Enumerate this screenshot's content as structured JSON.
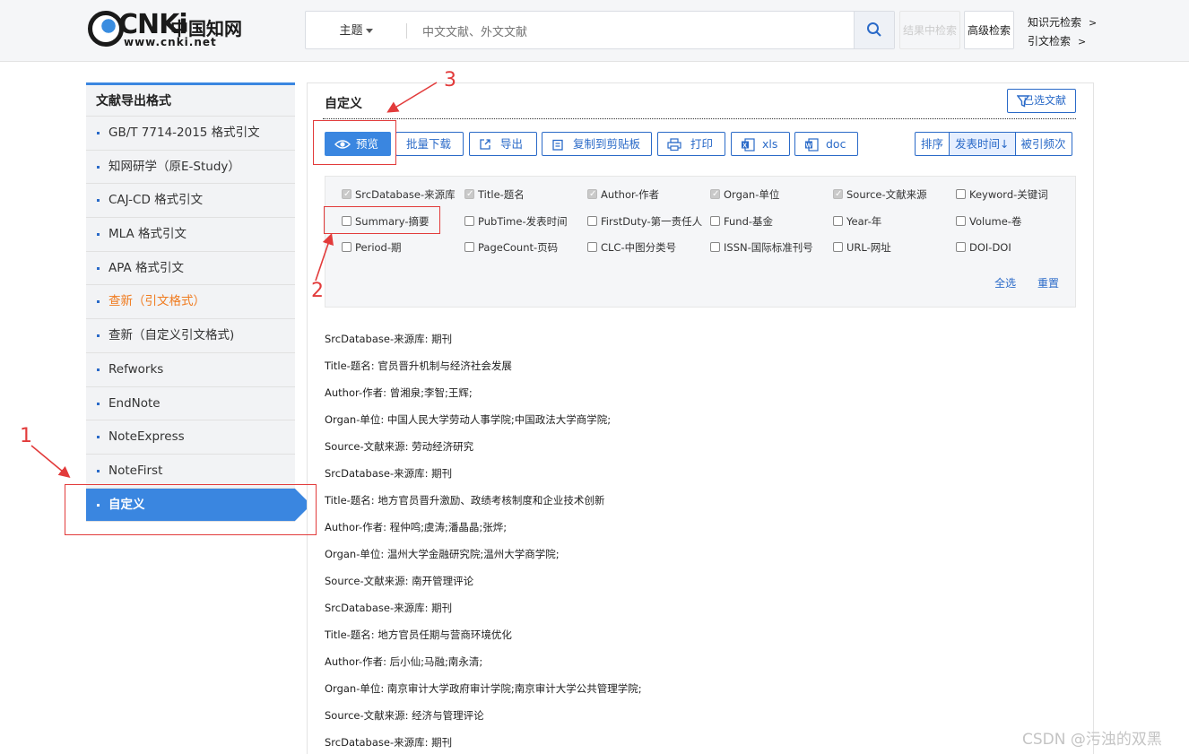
{
  "header": {
    "logo_word": "CNKi",
    "logo_cn": "中国知网",
    "logo_url": "www.cnki.net",
    "search_type": "主题",
    "search_placeholder": "中文文献、外文文献",
    "result_search": "结果中检索",
    "advanced_search": "高级检索",
    "link_knowledge": "知识元检索",
    "link_citation": "引文检索",
    "link_arrow": ">"
  },
  "sidebar": {
    "title": "文献导出格式",
    "items": [
      {
        "label": "GB/T 7714-2015 格式引文"
      },
      {
        "label": "知网研学（原E-Study）"
      },
      {
        "label": "CAJ-CD 格式引文"
      },
      {
        "label": "MLA 格式引文"
      },
      {
        "label": "APA 格式引文"
      },
      {
        "label": "查新（引文格式）"
      },
      {
        "label": "查新（自定义引文格式)"
      },
      {
        "label": "Refworks"
      },
      {
        "label": "EndNote"
      },
      {
        "label": "NoteExpress"
      },
      {
        "label": "NoteFirst"
      },
      {
        "label": "自定义"
      }
    ]
  },
  "main": {
    "title": "自定义",
    "selected_docs": "已选文献",
    "toolbar": {
      "preview": "预览",
      "batch_download": "批量下载",
      "export": "导出",
      "copy_clipboard": "复制到剪贴板",
      "print": "打印",
      "xls": "xls",
      "doc": "doc"
    },
    "sort": {
      "label": "排序",
      "publish_time": "发表时间",
      "publish_arrow": "↓",
      "cited": "被引频次"
    },
    "fields": [
      {
        "label": "SrcDatabase-来源库",
        "checked": true
      },
      {
        "label": "Title-题名",
        "checked": true
      },
      {
        "label": "Author-作者",
        "checked": true
      },
      {
        "label": "Organ-单位",
        "checked": true
      },
      {
        "label": "Source-文献来源",
        "checked": true
      },
      {
        "label": "Keyword-关键词",
        "checked": false
      },
      {
        "label": "Summary-摘要",
        "checked": false
      },
      {
        "label": "PubTime-发表时间",
        "checked": false
      },
      {
        "label": "FirstDuty-第一责任人",
        "checked": false
      },
      {
        "label": "Fund-基金",
        "checked": false
      },
      {
        "label": "Year-年",
        "checked": false
      },
      {
        "label": "Volume-卷",
        "checked": false
      },
      {
        "label": "Period-期",
        "checked": false
      },
      {
        "label": "PageCount-页码",
        "checked": false
      },
      {
        "label": "CLC-中图分类号",
        "checked": false
      },
      {
        "label": "ISSN-国际标准刊号",
        "checked": false
      },
      {
        "label": "URL-网址",
        "checked": false
      },
      {
        "label": "DOI-DOI",
        "checked": false
      }
    ],
    "select_all": "全选",
    "reset": "重置",
    "results": [
      "SrcDatabase-来源库: 期刊",
      "Title-题名: 官员晋升机制与经济社会发展",
      "Author-作者: 曾湘泉;李智;王辉;",
      "Organ-单位: 中国人民大学劳动人事学院;中国政法大学商学院;",
      "Source-文献来源: 劳动经济研究",
      "SrcDatabase-来源库: 期刊",
      "Title-题名: 地方官员晋升激励、政绩考核制度和企业技术创新",
      "Author-作者: 程仲鸣;虞涛;潘晶晶;张烨;",
      "Organ-单位: 温州大学金融研究院;温州大学商学院;",
      "Source-文献来源: 南开管理评论",
      "SrcDatabase-来源库: 期刊",
      "Title-题名: 地方官员任期与营商环境优化",
      "Author-作者: 后小仙;马融;南永清;",
      "Organ-单位: 南京审计大学政府审计学院;南京审计大学公共管理学院;",
      "Source-文献来源: 经济与管理评论",
      "SrcDatabase-来源库: 期刊"
    ]
  },
  "annotations": {
    "n1": "1",
    "n2": "2",
    "n3": "3",
    "color": "#e23b3b"
  },
  "watermark": "CSDN @污浊的双黑",
  "colors": {
    "accent": "#3a86e0",
    "link": "#2a6ac8",
    "orange": "#f07b1f"
  }
}
